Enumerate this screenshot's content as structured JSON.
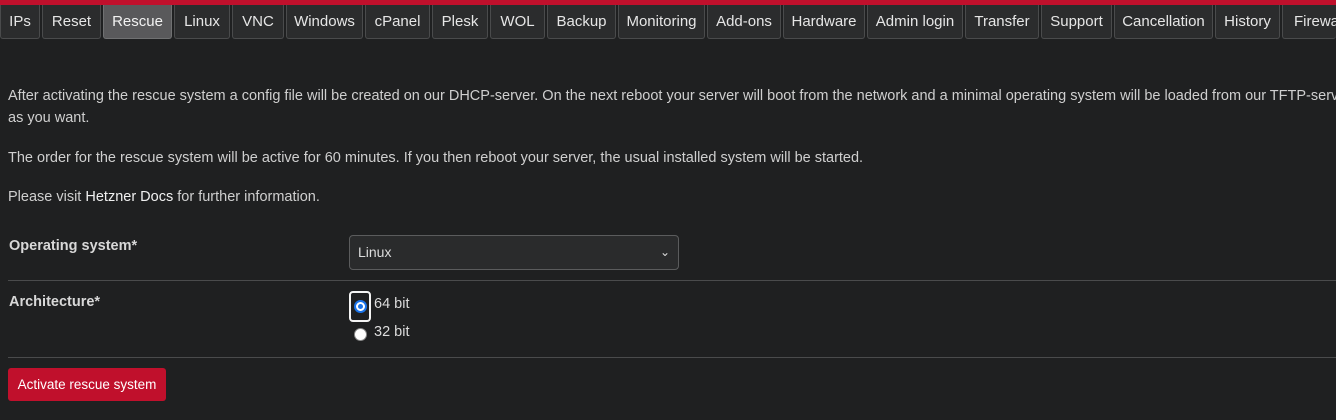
{
  "tabs": [
    {
      "label": "IPs",
      "active": false
    },
    {
      "label": "Reset",
      "active": false
    },
    {
      "label": "Rescue",
      "active": true
    },
    {
      "label": "Linux",
      "active": false
    },
    {
      "label": "VNC",
      "active": false
    },
    {
      "label": "Windows",
      "active": false
    },
    {
      "label": "cPanel",
      "active": false
    },
    {
      "label": "Plesk",
      "active": false
    },
    {
      "label": "WOL",
      "active": false
    },
    {
      "label": "Backup",
      "active": false
    },
    {
      "label": "Monitoring",
      "active": false
    },
    {
      "label": "Add-ons",
      "active": false
    },
    {
      "label": "Hardware",
      "active": false
    },
    {
      "label": "Admin login",
      "active": false
    },
    {
      "label": "Transfer",
      "active": false
    },
    {
      "label": "Support",
      "active": false
    },
    {
      "label": "Cancellation",
      "active": false
    },
    {
      "label": "History",
      "active": false
    },
    {
      "label": "Firewa",
      "active": false
    }
  ],
  "content": {
    "intro_line1": "After activating the rescue system a config file will be created on our DHCP-server. On the next reboot your server will boot from the network and a minimal operating system will be loaded from our TFTP-server. The",
    "intro_line2": "as you want.",
    "duration_text": "The order for the rescue system will be active for 60 minutes. If you then reboot your server, the usual installed system will be started.",
    "docs_prefix": "Please visit ",
    "docs_link": "Hetzner Docs",
    "docs_suffix": " for further information."
  },
  "form": {
    "os_label": "Operating system*",
    "os_value": "Linux",
    "arch_label": "Architecture*",
    "arch_options": [
      {
        "label": "64 bit",
        "selected": true
      },
      {
        "label": "32 bit",
        "selected": false
      }
    ],
    "submit_label": "Activate rescue system"
  },
  "colors": {
    "accent": "#c0102c",
    "background": "#1f2021",
    "active_tab": "#59595b"
  }
}
